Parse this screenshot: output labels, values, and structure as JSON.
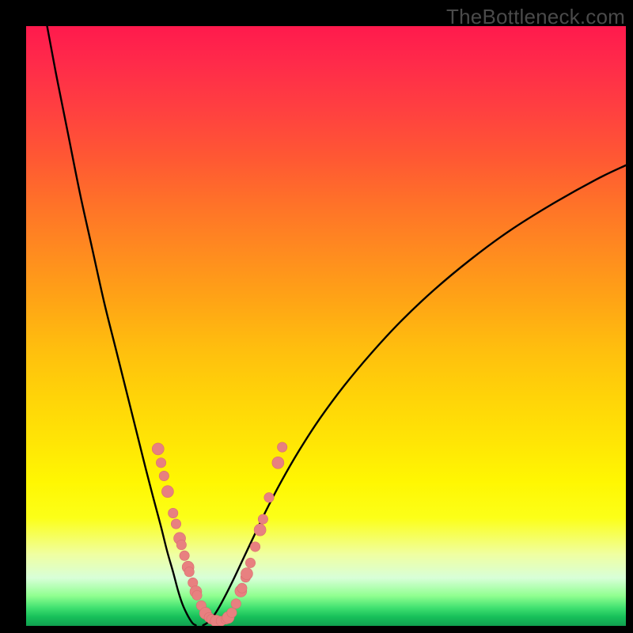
{
  "watermark": "TheBottleneck.com",
  "colors": {
    "curve_stroke": "#000000",
    "marker_fill": "#e88080",
    "marker_stroke": "#d86f6f"
  },
  "chart_data": {
    "type": "line",
    "title": "",
    "xlabel": "",
    "ylabel": "",
    "xlim": [
      0,
      100
    ],
    "ylim": [
      0,
      100
    ],
    "series": [
      {
        "name": "left-branch",
        "x": [
          3.5,
          5,
          7,
          9,
          11,
          13,
          15,
          17,
          18.5,
          20,
          21.3,
          22.5,
          23.5,
          24.5,
          25.3,
          26,
          26.7,
          27.3,
          27.8,
          28.3
        ],
        "y": [
          100,
          92,
          82,
          72,
          63,
          54,
          46,
          38,
          32,
          26,
          21,
          16.5,
          12.5,
          9,
          6,
          3.8,
          2.2,
          1.1,
          0.4,
          0.1
        ]
      },
      {
        "name": "right-branch",
        "x": [
          29.5,
          30.2,
          31,
          32,
          33.2,
          34.6,
          36.2,
          38,
          40,
          42.5,
          45.5,
          49,
          53,
          57.5,
          62.5,
          68,
          74,
          80.5,
          87.5,
          95,
          100
        ],
        "y": [
          0.1,
          0.5,
          1.3,
          2.8,
          5,
          7.8,
          11.2,
          15,
          19.2,
          24,
          29.2,
          34.6,
          40,
          45.4,
          50.8,
          56,
          61,
          65.8,
          70.2,
          74.4,
          76.8
        ]
      }
    ],
    "markers": [
      {
        "x": 22.0,
        "y": 29.5
      },
      {
        "x": 22.5,
        "y": 27.2
      },
      {
        "x": 23.0,
        "y": 25.0
      },
      {
        "x": 23.6,
        "y": 22.4
      },
      {
        "x": 24.5,
        "y": 18.8
      },
      {
        "x": 25.0,
        "y": 17.0
      },
      {
        "x": 25.6,
        "y": 14.6
      },
      {
        "x": 25.9,
        "y": 13.5
      },
      {
        "x": 26.4,
        "y": 11.7
      },
      {
        "x": 27.0,
        "y": 9.8
      },
      {
        "x": 27.2,
        "y": 9.0
      },
      {
        "x": 27.8,
        "y": 7.2
      },
      {
        "x": 28.3,
        "y": 5.7
      },
      {
        "x": 28.5,
        "y": 5.1
      },
      {
        "x": 29.2,
        "y": 3.4
      },
      {
        "x": 29.9,
        "y": 2.1
      },
      {
        "x": 30.5,
        "y": 1.4
      },
      {
        "x": 30.9,
        "y": 1.1
      },
      {
        "x": 31.7,
        "y": 0.8
      },
      {
        "x": 32.5,
        "y": 0.8
      },
      {
        "x": 33.3,
        "y": 1.1
      },
      {
        "x": 33.7,
        "y": 1.4
      },
      {
        "x": 34.3,
        "y": 2.2
      },
      {
        "x": 35.0,
        "y": 3.7
      },
      {
        "x": 35.8,
        "y": 5.8
      },
      {
        "x": 36.0,
        "y": 6.3
      },
      {
        "x": 36.6,
        "y": 8.1
      },
      {
        "x": 36.8,
        "y": 8.7
      },
      {
        "x": 37.4,
        "y": 10.5
      },
      {
        "x": 38.2,
        "y": 13.2
      },
      {
        "x": 39.0,
        "y": 16.0
      },
      {
        "x": 39.5,
        "y": 17.8
      },
      {
        "x": 40.5,
        "y": 21.4
      },
      {
        "x": 42.0,
        "y": 27.2
      },
      {
        "x": 42.7,
        "y": 29.8
      }
    ]
  }
}
